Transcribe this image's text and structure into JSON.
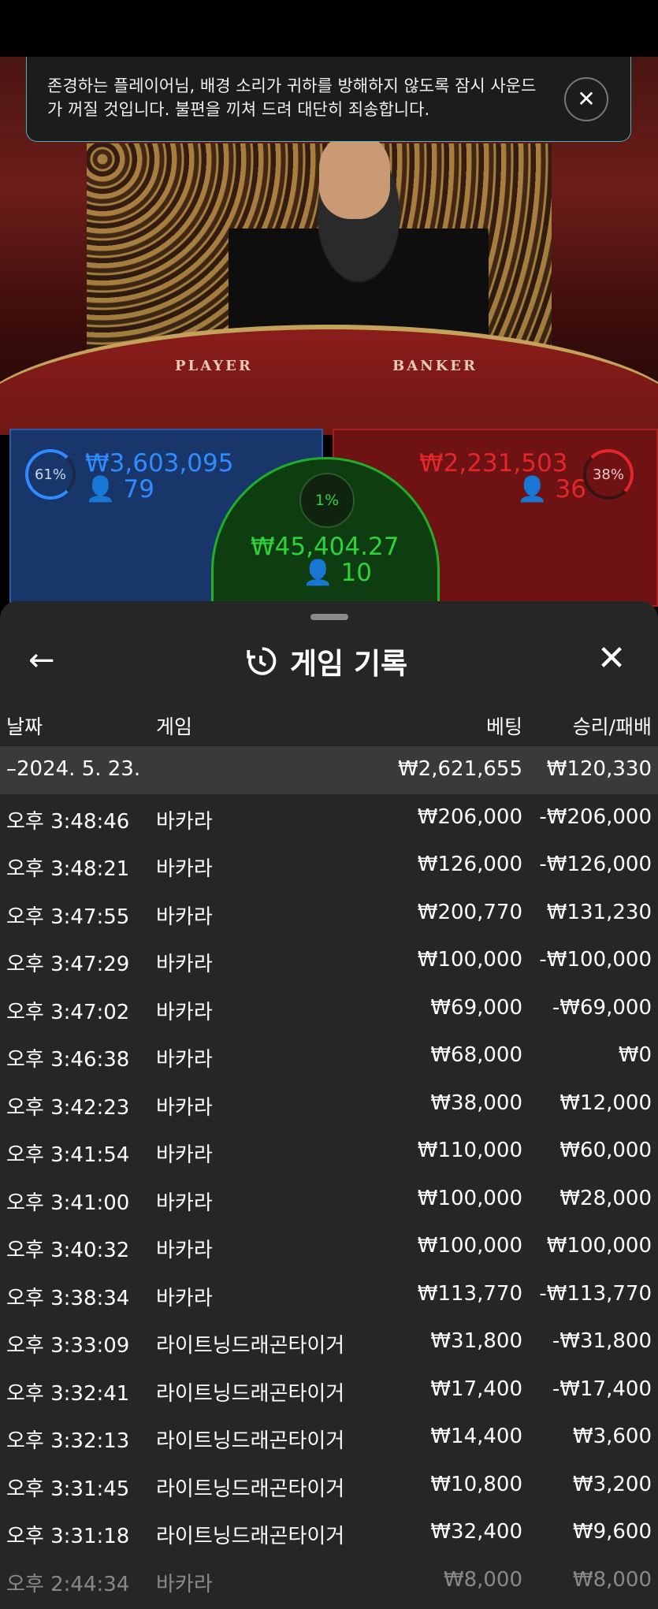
{
  "notice": {
    "text": "존경하는 플레이어님, 배경 소리가 귀하를 방해하지 않도록 잠시 사운드가 꺼질 것입니다. 불편을 끼쳐 드려 대단히 죄송합니다."
  },
  "table_labels": {
    "player": "PLAYER",
    "banker": "BANKER"
  },
  "bets": {
    "player": {
      "percent": "61%",
      "amount": "₩3,603,095",
      "count": "79"
    },
    "tie": {
      "percent": "1%",
      "amount": "₩45,404.27",
      "count": "10"
    },
    "banker": {
      "percent": "38%",
      "amount": "₩2,231,503",
      "count": "36"
    }
  },
  "sheet": {
    "title": "게임 기록",
    "columns": {
      "date": "날짜",
      "game": "게임",
      "bet": "베팅",
      "winloss": "승리/패배"
    },
    "date_group": {
      "label": "–2024. 5. 23.",
      "bet": "₩2,621,655",
      "winloss": "₩120,330"
    },
    "rows": [
      {
        "time": "오후 3:48:46",
        "game": "바카라",
        "bet": "₩206,000",
        "winloss": "-₩206,000"
      },
      {
        "time": "오후 3:48:21",
        "game": "바카라",
        "bet": "₩126,000",
        "winloss": "-₩126,000"
      },
      {
        "time": "오후 3:47:55",
        "game": "바카라",
        "bet": "₩200,770",
        "winloss": "₩131,230"
      },
      {
        "time": "오후 3:47:29",
        "game": "바카라",
        "bet": "₩100,000",
        "winloss": "-₩100,000"
      },
      {
        "time": "오후 3:47:02",
        "game": "바카라",
        "bet": "₩69,000",
        "winloss": "-₩69,000"
      },
      {
        "time": "오후 3:46:38",
        "game": "바카라",
        "bet": "₩68,000",
        "winloss": "₩0"
      },
      {
        "time": "오후 3:42:23",
        "game": "바카라",
        "bet": "₩38,000",
        "winloss": "₩12,000"
      },
      {
        "time": "오후 3:41:54",
        "game": "바카라",
        "bet": "₩110,000",
        "winloss": "₩60,000"
      },
      {
        "time": "오후 3:41:00",
        "game": "바카라",
        "bet": "₩100,000",
        "winloss": "₩28,000"
      },
      {
        "time": "오후 3:40:32",
        "game": "바카라",
        "bet": "₩100,000",
        "winloss": "₩100,000"
      },
      {
        "time": "오후 3:38:34",
        "game": "바카라",
        "bet": "₩113,770",
        "winloss": "-₩113,770"
      },
      {
        "time": "오후 3:33:09",
        "game": "라이트닝드래곤타이거",
        "bet": "₩31,800",
        "winloss": "-₩31,800"
      },
      {
        "time": "오후 3:32:41",
        "game": "라이트닝드래곤타이거",
        "bet": "₩17,400",
        "winloss": "-₩17,400"
      },
      {
        "time": "오후 3:32:13",
        "game": "라이트닝드래곤타이거",
        "bet": "₩14,400",
        "winloss": "₩3,600"
      },
      {
        "time": "오후 3:31:45",
        "game": "라이트닝드래곤타이거",
        "bet": "₩10,800",
        "winloss": "₩3,200"
      },
      {
        "time": "오후 3:31:18",
        "game": "라이트닝드래곤타이거",
        "bet": "₩32,400",
        "winloss": "₩9,600"
      },
      {
        "time": "오후 2:44:34",
        "game": "바카라",
        "bet": "₩8,000",
        "winloss": "₩8,000"
      }
    ]
  },
  "colors": {
    "player": "#2f8bff",
    "banker": "#e3262a",
    "tie": "#2fd23a",
    "sheet_bg": "#262626",
    "notice_border": "#4fb3b9"
  },
  "icons": {
    "back": "arrow-left-icon",
    "history": "history-icon",
    "close": "close-icon",
    "notice_close": "close-icon",
    "user": "user-icon"
  }
}
